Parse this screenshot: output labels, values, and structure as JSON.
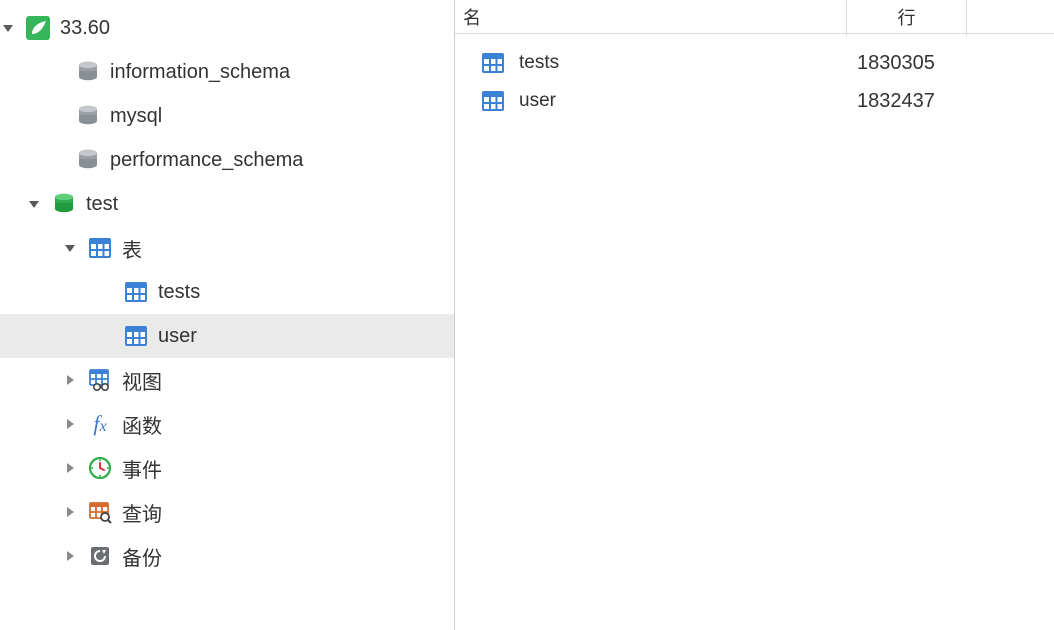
{
  "sidebar": {
    "connection_name": "33.60",
    "databases": {
      "information_schema": "information_schema",
      "mysql": "mysql",
      "performance_schema": "performance_schema",
      "test": "test"
    },
    "nodes": {
      "tables_folder": "表",
      "views_folder": "视图",
      "functions_folder": "函数",
      "events_folder": "事件",
      "queries_folder": "查询",
      "backups_folder": "备份"
    },
    "tables": {
      "tests": "tests",
      "user": "user"
    }
  },
  "main": {
    "headers": {
      "name": "名",
      "rows": "行"
    },
    "rows": [
      {
        "name": "tests",
        "count": "1830305"
      },
      {
        "name": "user",
        "count": "1832437"
      }
    ]
  },
  "icons": {
    "app": "navicat-icon",
    "db_gray": "database-icon",
    "db_green": "database-icon",
    "table": "table-icon",
    "views": "views-icon",
    "fx": "function-icon",
    "clock": "event-icon",
    "query": "query-icon",
    "backup": "backup-icon"
  }
}
